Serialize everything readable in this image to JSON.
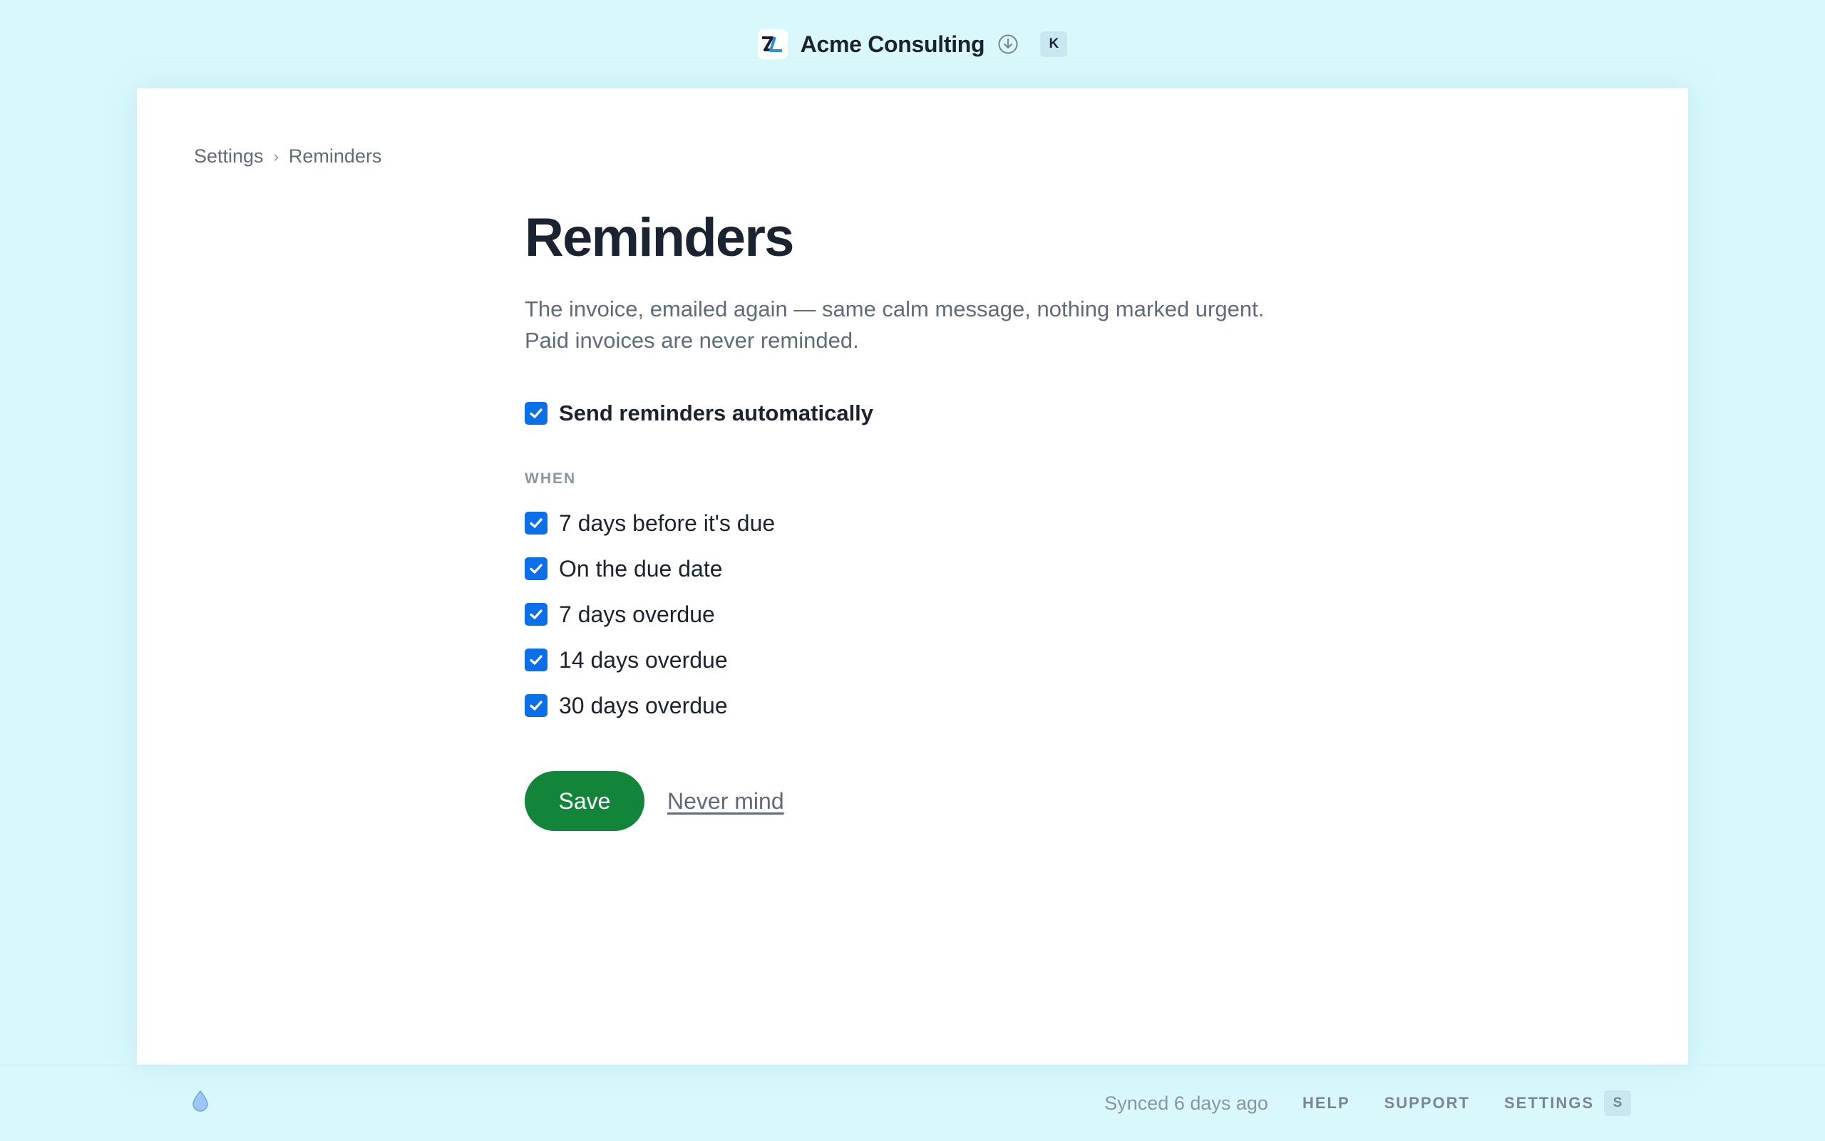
{
  "header": {
    "company_name": "Acme Consulting",
    "logo_icon": "zl-logo-icon",
    "download_icon": "download-circle-icon",
    "shortcut_key": "K"
  },
  "breadcrumb": {
    "items": [
      {
        "label": "Settings"
      },
      {
        "label": "Reminders"
      }
    ],
    "separator": "›"
  },
  "page": {
    "title": "Reminders",
    "description_line1": "The invoice, emailed again — same calm message, nothing marked urgent.",
    "description_line2": "Paid invoices are never reminded."
  },
  "master_toggle": {
    "label": "Send reminders automatically",
    "checked": true
  },
  "when": {
    "heading": "WHEN",
    "options": [
      {
        "label": "7 days before it's due",
        "checked": true
      },
      {
        "label": "On the due date",
        "checked": true
      },
      {
        "label": "7 days overdue",
        "checked": true
      },
      {
        "label": "14 days overdue",
        "checked": true
      },
      {
        "label": "30 days overdue",
        "checked": true
      }
    ]
  },
  "actions": {
    "save_label": "Save",
    "cancel_label": "Never mind"
  },
  "footer": {
    "drop_icon": "droplet-icon",
    "synced_text": "Synced 6 days ago",
    "help_label": "HELP",
    "support_label": "SUPPORT",
    "settings_label": "SETTINGS",
    "settings_shortcut": "S"
  },
  "colors": {
    "background": "#d9f8fc",
    "accent_blue": "#0a6fe8",
    "save_green": "#12853a",
    "text_dark": "#1b2330",
    "text_muted": "#5f6b7a"
  }
}
